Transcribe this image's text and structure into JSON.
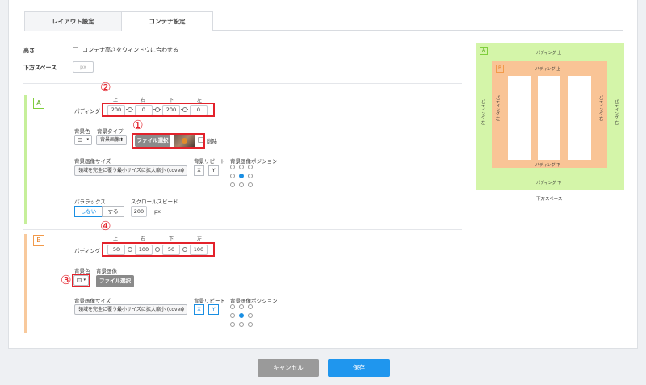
{
  "tabs": [
    {
      "label": "レイアウト設定",
      "active": false
    },
    {
      "label": "コンテナ設定",
      "active": true
    }
  ],
  "height": {
    "label": "高さ",
    "checkbox_label": "コンテナ高さをウィンドウに合わせる"
  },
  "bottom_space": {
    "label": "下方スペース",
    "placeholder": "px"
  },
  "section_a": {
    "badge": "A",
    "marker": "②",
    "padding": {
      "label": "パディング",
      "dirs": [
        "上",
        "右",
        "下",
        "左"
      ],
      "values": [
        "200",
        "0",
        "200",
        "0"
      ]
    },
    "bg_color_label": "背景色",
    "bg_type_label": "背景タイプ",
    "bg_type_value": "背景画像",
    "marker_file": "①",
    "file_button": "ファイル選択",
    "delete_label": "削除",
    "bg_size_label": "背景画像サイズ",
    "bg_size_value": "領域を完全に覆う最小サイズに拡大縮小 (cover)",
    "bg_repeat_label": "背景リピート",
    "bg_repeat_x": "X",
    "bg_repeat_y": "Y",
    "bg_pos_label": "背景画像ポジション",
    "parallax_label": "パララックス",
    "parallax_off": "しない",
    "parallax_on": "する",
    "scroll_speed_label": "スクロールスピード",
    "scroll_speed_value": "200",
    "scroll_speed_unit": "px"
  },
  "section_b": {
    "badge": "B",
    "marker": "④",
    "padding": {
      "label": "パディング",
      "dirs": [
        "上",
        "右",
        "下",
        "左"
      ],
      "values": [
        "50",
        "100",
        "50",
        "100"
      ]
    },
    "marker_color": "③",
    "bg_color_label": "背景色",
    "bg_image_label": "背景画像",
    "file_button": "ファイル選択",
    "bg_size_label": "背景画像サイズ",
    "bg_size_value": "領域を完全に覆う最小サイズに拡大縮小 (cover)",
    "bg_repeat_label": "背景リピート",
    "bg_repeat_x": "X",
    "bg_repeat_y": "Y",
    "bg_pos_label": "背景画像ポジション"
  },
  "preview": {
    "badge_a": "A",
    "badge_b": "B",
    "a_top": "パディング 上",
    "a_bottom": "パディング 下",
    "a_left": "パディング 左",
    "a_right": "パディング 右",
    "b_top": "パディング 上",
    "b_bottom": "パディング 下",
    "b_left": "パディング 左",
    "b_right": "パディング 右",
    "caption": "下方スペース"
  },
  "footer": {
    "cancel": "キャンセル",
    "save": "保存"
  },
  "colors": {
    "accent_red": "#e3222b",
    "blue": "#1a8fe3",
    "green": "#c6ef9a",
    "orange": "#f8c99c"
  }
}
